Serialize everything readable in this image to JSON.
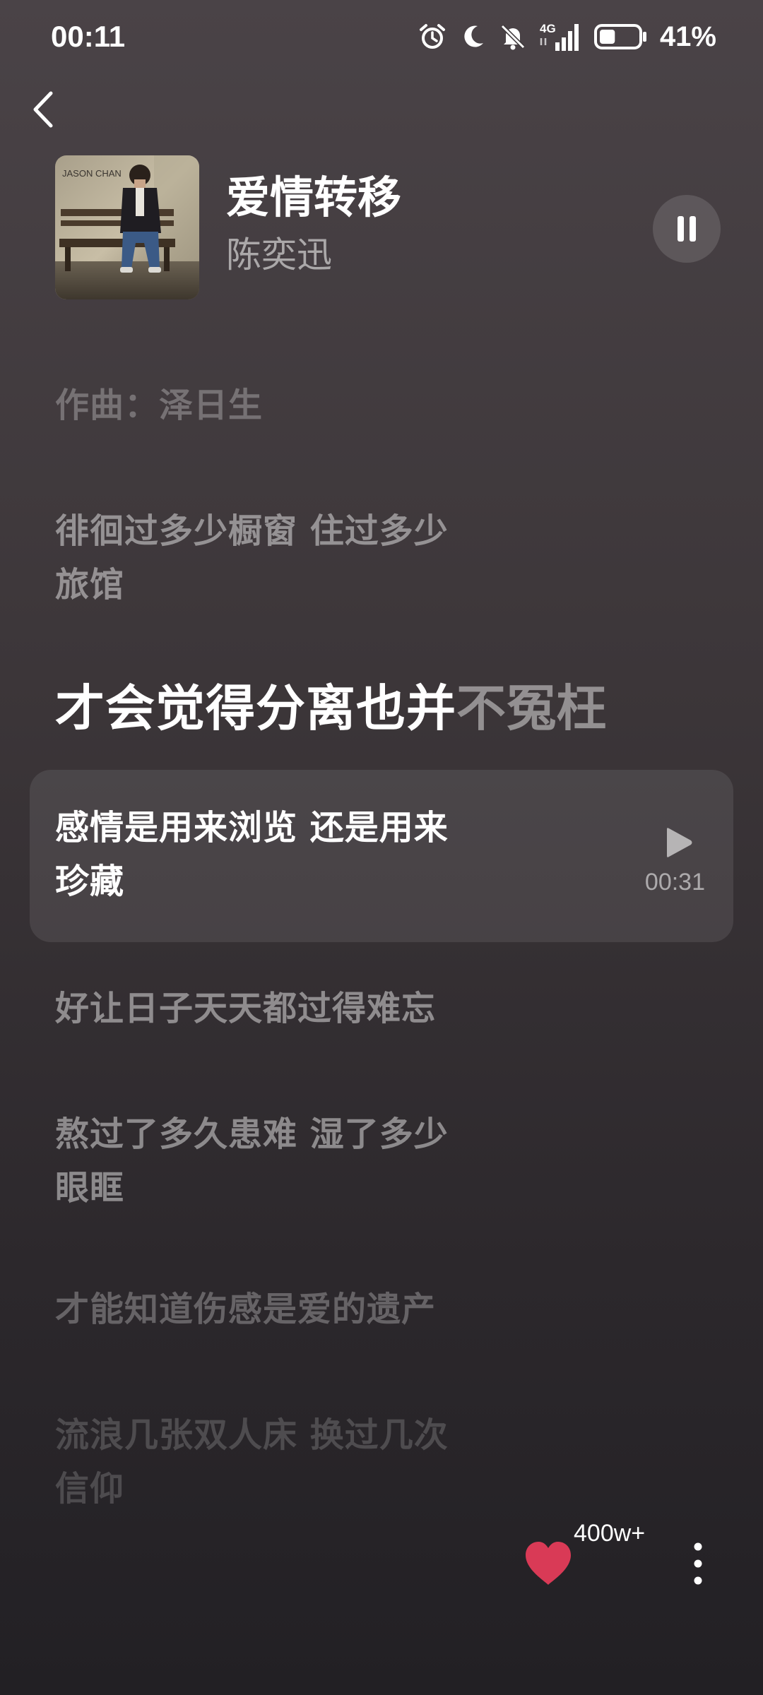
{
  "status_bar": {
    "time": "00:11",
    "network": "4G",
    "battery_percent": "41%",
    "battery_level": 0.41,
    "icons": [
      "alarm-icon",
      "moon-icon",
      "bell-off-icon",
      "signal-icon",
      "battery-icon"
    ]
  },
  "song": {
    "title": "爱情转移",
    "artist": "陈奕迅",
    "state": "playing"
  },
  "lyrics": {
    "composer": "作曲：泽日生",
    "line_before_1": "徘徊过多少橱窗 住过多少旅馆",
    "current_sung": "才会觉得分离也并",
    "current_unsung": "不冤枉",
    "selected": {
      "text": "感情是用来浏览 还是用来珍藏",
      "timestamp": "00:31"
    },
    "line_after_1": "好让日子天天都过得难忘",
    "line_after_2": "熬过了多久患难 湿了多少眼眶",
    "line_after_3": "才能知道伤感是爱的遗产",
    "line_after_4": "流浪几张双人床 换过几次信仰"
  },
  "actions": {
    "like_count": "400w+"
  },
  "colors": {
    "heart": "#d93a56",
    "background_top": "#4a4347",
    "background_bottom": "#222024"
  }
}
